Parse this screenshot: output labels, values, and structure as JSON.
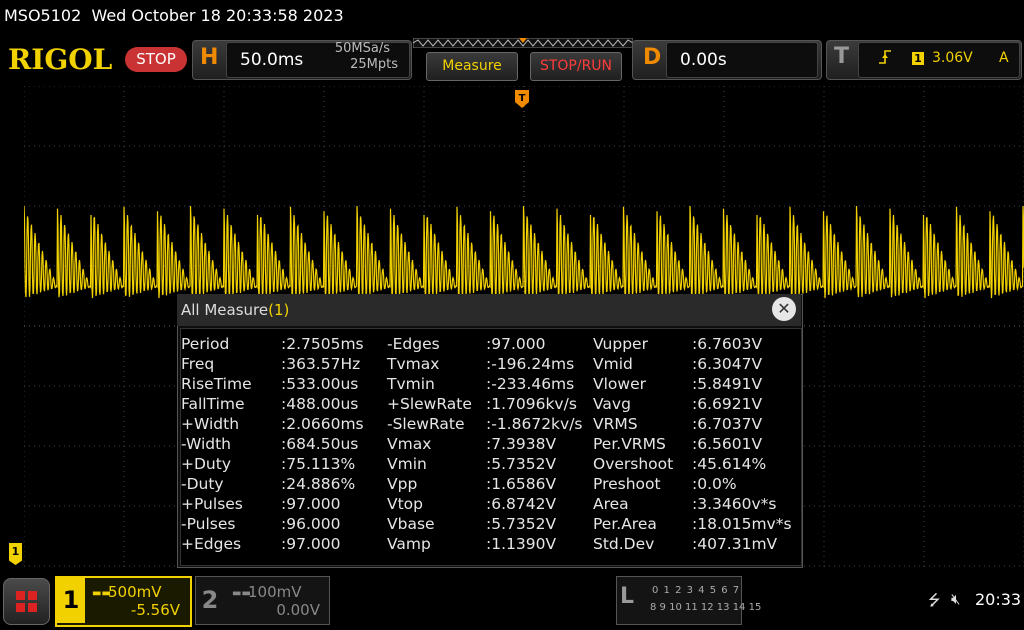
{
  "status": {
    "model": "MSO5102",
    "datetime": "Wed October 18 20:33:58 2023"
  },
  "brand": {
    "logo": "RIGOL"
  },
  "run_state": {
    "label": "STOP"
  },
  "horizontal": {
    "letter": "H",
    "timebase": "50.0ms",
    "sample_rate": "50MSa/s",
    "memory_depth": "25Mpts"
  },
  "buttons": {
    "measure": "Measure",
    "stop_run": "STOP/RUN"
  },
  "delay": {
    "letter": "D",
    "value": "0.00s"
  },
  "trigger": {
    "letter": "T",
    "edge_icon": "rising-edge-icon",
    "source": "1",
    "level": "3.06V",
    "mode": "A"
  },
  "markers": {
    "trigger": "T",
    "ch1": "1"
  },
  "measure_window": {
    "title": "All Measure",
    "count": "(1)",
    "close": "✕",
    "columns": [
      [
        {
          "label": "Period",
          "value": ":2.7505ms"
        },
        {
          "label": "Freq",
          "value": ":363.57Hz"
        },
        {
          "label": "RiseTime",
          "value": ":533.00us"
        },
        {
          "label": "FallTime",
          "value": ":488.00us"
        },
        {
          "label": "+Width",
          "value": ":2.0660ms"
        },
        {
          "label": "-Width",
          "value": ":684.50us"
        },
        {
          "label": "+Duty",
          "value": ":75.113%"
        },
        {
          "label": "-Duty",
          "value": ":24.886%"
        },
        {
          "label": "+Pulses",
          "value": ":97.000"
        },
        {
          "label": "-Pulses",
          "value": ":96.000"
        },
        {
          "label": "+Edges",
          "value": ":97.000"
        }
      ],
      [
        {
          "label": "-Edges",
          "value": ":97.000"
        },
        {
          "label": "Tvmax",
          "value": ":-196.24ms"
        },
        {
          "label": "Tvmin",
          "value": ":-233.46ms"
        },
        {
          "label": "+SlewRate",
          "value": ":1.7096kv/s"
        },
        {
          "label": "-SlewRate",
          "value": ":-1.8672kv/s"
        },
        {
          "label": "Vmax",
          "value": ":7.3938V"
        },
        {
          "label": "Vmin",
          "value": ":5.7352V"
        },
        {
          "label": "Vpp",
          "value": ":1.6586V"
        },
        {
          "label": "Vtop",
          "value": ":6.8742V"
        },
        {
          "label": "Vbase",
          "value": ":5.7352V"
        },
        {
          "label": "Vamp",
          "value": ":1.1390V"
        }
      ],
      [
        {
          "label": "Vupper",
          "value": ":6.7603V"
        },
        {
          "label": "Vmid",
          "value": ":6.3047V"
        },
        {
          "label": "Vlower",
          "value": ":5.8491V"
        },
        {
          "label": "Vavg",
          "value": ":6.6921V"
        },
        {
          "label": "VRMS",
          "value": ":6.7037V"
        },
        {
          "label": "Per.VRMS",
          "value": ":6.5601V"
        },
        {
          "label": "Overshoot",
          "value": ":45.614%"
        },
        {
          "label": "Preshoot",
          "value": ":0.0%"
        },
        {
          "label": "Area",
          "value": ":3.3460v*s"
        },
        {
          "label": "Per.Area",
          "value": ":18.015mv*s"
        },
        {
          "label": "Std.Dev",
          "value": ":407.31mV"
        }
      ]
    ]
  },
  "channels": {
    "ch1": {
      "number": "1",
      "scale": "500mV",
      "offset": "-5.56V",
      "coupling_icon": "dc-coupling-icon",
      "color": "#f2d100"
    },
    "ch2": {
      "number": "2",
      "scale": "100mV",
      "offset": "0.00V",
      "coupling_icon": "dc-coupling-icon",
      "color": "#888888"
    }
  },
  "logic": {
    "letter": "L",
    "row1": "0 1 2 3  4 5 6 7",
    "row2": "8 9 10 11 12 13 14 15"
  },
  "system": {
    "clock": "20:33"
  },
  "colors": {
    "trace": "#f2d100",
    "brand": "#f2d100",
    "stop": "#c93333",
    "accent": "#f08a00"
  }
}
